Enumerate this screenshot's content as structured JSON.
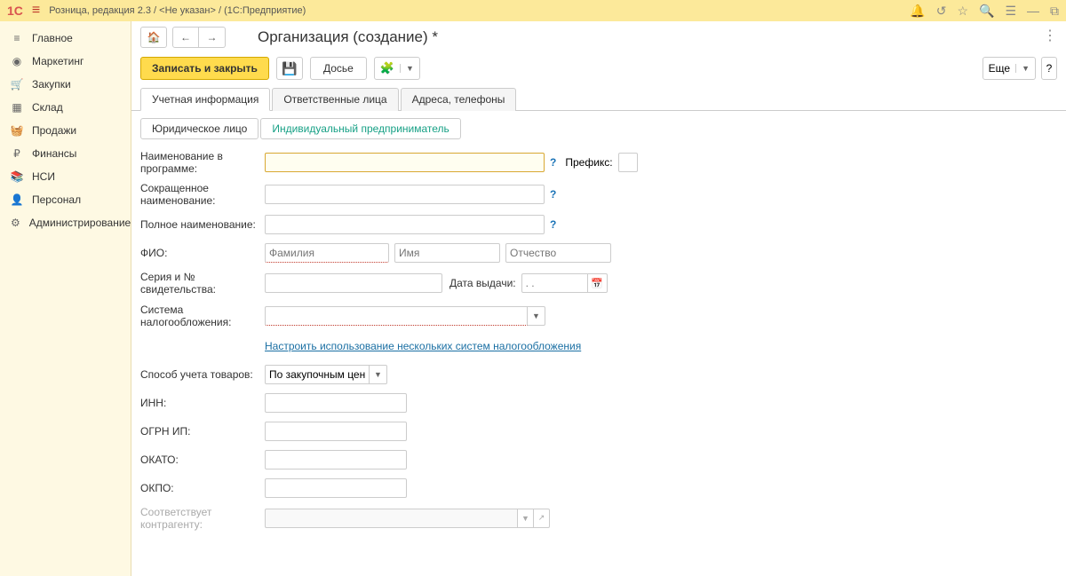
{
  "topbar": {
    "logo": "1С",
    "breadcrumb": "Розница, редакция 2.3 / <Не указан> /  (1С:Предприятие)"
  },
  "sidebar": {
    "items": [
      {
        "icon": "≡",
        "label": "Главное"
      },
      {
        "icon": "◉",
        "label": "Маркетинг"
      },
      {
        "icon": "🛒",
        "label": "Закупки"
      },
      {
        "icon": "▦",
        "label": "Склад"
      },
      {
        "icon": "🧺",
        "label": "Продажи"
      },
      {
        "icon": "₽",
        "label": "Финансы"
      },
      {
        "icon": "📚",
        "label": "НСИ"
      },
      {
        "icon": "👤",
        "label": "Персонал"
      },
      {
        "icon": "⚙",
        "label": "Администрирование"
      }
    ]
  },
  "header": {
    "title": "Организация (создание) *"
  },
  "toolbar": {
    "save_close": "Записать и закрыть",
    "dossier": "Досье",
    "more": "Еще"
  },
  "tabs": {
    "t0": "Учетная информация",
    "t1": "Ответственные лица",
    "t2": "Адреса, телефоны"
  },
  "subtabs": {
    "s0": "Юридическое лицо",
    "s1": "Индивидуальный предприниматель"
  },
  "form": {
    "name_prog_label": "Наименование в программе:",
    "prefix_label": "Префикс:",
    "short_name_label": "Сокращенное наименование:",
    "full_name_label": "Полное наименование:",
    "fio_label": "ФИО:",
    "fam_ph": "Фамилия",
    "imya_ph": "Имя",
    "otch_ph": "Отчество",
    "serial_label": "Серия и № свидетельства:",
    "date_label": "Дата выдачи:",
    "date_ph": ". .",
    "tax_label": "Система налогообложения:",
    "tax_link": "Настроить использование нескольких систем налогообложения",
    "method_label": "Способ учета товаров:",
    "method_value": "По закупочным ценам",
    "inn_label": "ИНН:",
    "ogrn_label": "ОГРН ИП:",
    "okato_label": "ОКАТО:",
    "okpo_label": "ОКПО:",
    "contra_label": "Соответствует контрагенту:"
  }
}
